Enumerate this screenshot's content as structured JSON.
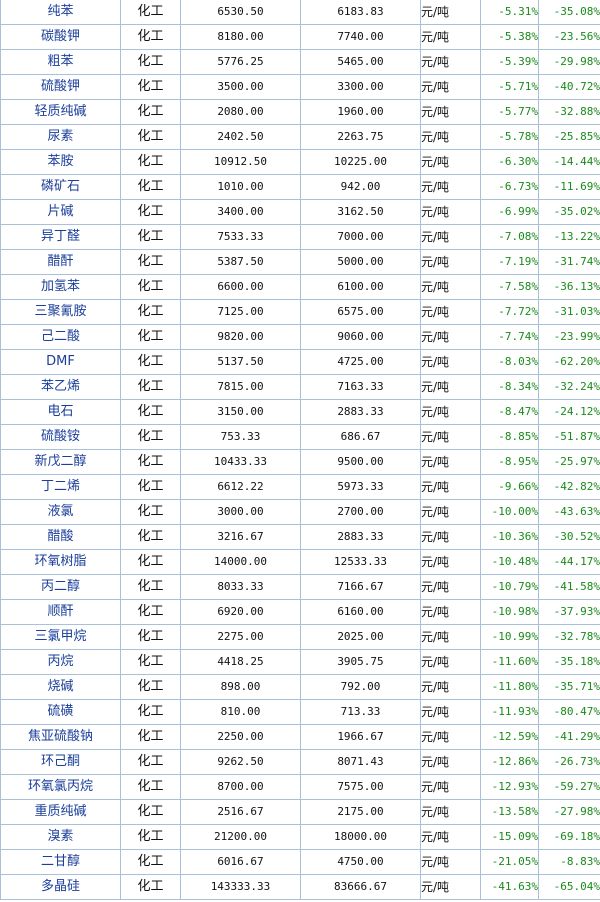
{
  "table": {
    "rows": [
      {
        "name": "纯苯",
        "category": "化工",
        "price_prev": "6530.50",
        "price_now": "6183.83",
        "unit": "元/吨",
        "change_period": "-5.31%",
        "change_year": "-35.08%"
      },
      {
        "name": "碳酸钾",
        "category": "化工",
        "price_prev": "8180.00",
        "price_now": "7740.00",
        "unit": "元/吨",
        "change_period": "-5.38%",
        "change_year": "-23.56%"
      },
      {
        "name": "粗苯",
        "category": "化工",
        "price_prev": "5776.25",
        "price_now": "5465.00",
        "unit": "元/吨",
        "change_period": "-5.39%",
        "change_year": "-29.98%"
      },
      {
        "name": "硫酸钾",
        "category": "化工",
        "price_prev": "3500.00",
        "price_now": "3300.00",
        "unit": "元/吨",
        "change_period": "-5.71%",
        "change_year": "-40.72%"
      },
      {
        "name": "轻质纯碱",
        "category": "化工",
        "price_prev": "2080.00",
        "price_now": "1960.00",
        "unit": "元/吨",
        "change_period": "-5.77%",
        "change_year": "-32.88%"
      },
      {
        "name": "尿素",
        "category": "化工",
        "price_prev": "2402.50",
        "price_now": "2263.75",
        "unit": "元/吨",
        "change_period": "-5.78%",
        "change_year": "-25.85%"
      },
      {
        "name": "苯胺",
        "category": "化工",
        "price_prev": "10912.50",
        "price_now": "10225.00",
        "unit": "元/吨",
        "change_period": "-6.30%",
        "change_year": "-14.44%"
      },
      {
        "name": "磷矿石",
        "category": "化工",
        "price_prev": "1010.00",
        "price_now": "942.00",
        "unit": "元/吨",
        "change_period": "-6.73%",
        "change_year": "-11.69%"
      },
      {
        "name": "片碱",
        "category": "化工",
        "price_prev": "3400.00",
        "price_now": "3162.50",
        "unit": "元/吨",
        "change_period": "-6.99%",
        "change_year": "-35.02%"
      },
      {
        "name": "异丁醛",
        "category": "化工",
        "price_prev": "7533.33",
        "price_now": "7000.00",
        "unit": "元/吨",
        "change_period": "-7.08%",
        "change_year": "-13.22%"
      },
      {
        "name": "醋酐",
        "category": "化工",
        "price_prev": "5387.50",
        "price_now": "5000.00",
        "unit": "元/吨",
        "change_period": "-7.19%",
        "change_year": "-31.74%"
      },
      {
        "name": "加氢苯",
        "category": "化工",
        "price_prev": "6600.00",
        "price_now": "6100.00",
        "unit": "元/吨",
        "change_period": "-7.58%",
        "change_year": "-36.13%"
      },
      {
        "name": "三聚氰胺",
        "category": "化工",
        "price_prev": "7125.00",
        "price_now": "6575.00",
        "unit": "元/吨",
        "change_period": "-7.72%",
        "change_year": "-31.03%"
      },
      {
        "name": "己二酸",
        "category": "化工",
        "price_prev": "9820.00",
        "price_now": "9060.00",
        "unit": "元/吨",
        "change_period": "-7.74%",
        "change_year": "-23.99%"
      },
      {
        "name": "DMF",
        "category": "化工",
        "price_prev": "5137.50",
        "price_now": "4725.00",
        "unit": "元/吨",
        "change_period": "-8.03%",
        "change_year": "-62.20%"
      },
      {
        "name": "苯乙烯",
        "category": "化工",
        "price_prev": "7815.00",
        "price_now": "7163.33",
        "unit": "元/吨",
        "change_period": "-8.34%",
        "change_year": "-32.24%"
      },
      {
        "name": "电石",
        "category": "化工",
        "price_prev": "3150.00",
        "price_now": "2883.33",
        "unit": "元/吨",
        "change_period": "-8.47%",
        "change_year": "-24.12%"
      },
      {
        "name": "硫酸铵",
        "category": "化工",
        "price_prev": "753.33",
        "price_now": "686.67",
        "unit": "元/吨",
        "change_period": "-8.85%",
        "change_year": "-51.87%"
      },
      {
        "name": "新戊二醇",
        "category": "化工",
        "price_prev": "10433.33",
        "price_now": "9500.00",
        "unit": "元/吨",
        "change_period": "-8.95%",
        "change_year": "-25.97%"
      },
      {
        "name": "丁二烯",
        "category": "化工",
        "price_prev": "6612.22",
        "price_now": "5973.33",
        "unit": "元/吨",
        "change_period": "-9.66%",
        "change_year": "-42.82%"
      },
      {
        "name": "液氯",
        "category": "化工",
        "price_prev": "3000.00",
        "price_now": "2700.00",
        "unit": "元/吨",
        "change_period": "-10.00%",
        "change_year": "-43.63%"
      },
      {
        "name": "醋酸",
        "category": "化工",
        "price_prev": "3216.67",
        "price_now": "2883.33",
        "unit": "元/吨",
        "change_period": "-10.36%",
        "change_year": "-30.52%"
      },
      {
        "name": "环氧树脂",
        "category": "化工",
        "price_prev": "14000.00",
        "price_now": "12533.33",
        "unit": "元/吨",
        "change_period": "-10.48%",
        "change_year": "-44.17%"
      },
      {
        "name": "丙二醇",
        "category": "化工",
        "price_prev": "8033.33",
        "price_now": "7166.67",
        "unit": "元/吨",
        "change_period": "-10.79%",
        "change_year": "-41.58%"
      },
      {
        "name": "顺酐",
        "category": "化工",
        "price_prev": "6920.00",
        "price_now": "6160.00",
        "unit": "元/吨",
        "change_period": "-10.98%",
        "change_year": "-37.93%"
      },
      {
        "name": "三氯甲烷",
        "category": "化工",
        "price_prev": "2275.00",
        "price_now": "2025.00",
        "unit": "元/吨",
        "change_period": "-10.99%",
        "change_year": "-32.78%"
      },
      {
        "name": "丙烷",
        "category": "化工",
        "price_prev": "4418.25",
        "price_now": "3905.75",
        "unit": "元/吨",
        "change_period": "-11.60%",
        "change_year": "-35.18%"
      },
      {
        "name": "烧碱",
        "category": "化工",
        "price_prev": "898.00",
        "price_now": "792.00",
        "unit": "元/吨",
        "change_period": "-11.80%",
        "change_year": "-35.71%"
      },
      {
        "name": "硫磺",
        "category": "化工",
        "price_prev": "810.00",
        "price_now": "713.33",
        "unit": "元/吨",
        "change_period": "-11.93%",
        "change_year": "-80.47%"
      },
      {
        "name": "焦亚硫酸钠",
        "category": "化工",
        "price_prev": "2250.00",
        "price_now": "1966.67",
        "unit": "元/吨",
        "change_period": "-12.59%",
        "change_year": "-41.29%"
      },
      {
        "name": "环己酮",
        "category": "化工",
        "price_prev": "9262.50",
        "price_now": "8071.43",
        "unit": "元/吨",
        "change_period": "-12.86%",
        "change_year": "-26.73%"
      },
      {
        "name": "环氧氯丙烷",
        "category": "化工",
        "price_prev": "8700.00",
        "price_now": "7575.00",
        "unit": "元/吨",
        "change_period": "-12.93%",
        "change_year": "-59.27%"
      },
      {
        "name": "重质纯碱",
        "category": "化工",
        "price_prev": "2516.67",
        "price_now": "2175.00",
        "unit": "元/吨",
        "change_period": "-13.58%",
        "change_year": "-27.98%"
      },
      {
        "name": "溴素",
        "category": "化工",
        "price_prev": "21200.00",
        "price_now": "18000.00",
        "unit": "元/吨",
        "change_period": "-15.09%",
        "change_year": "-69.18%"
      },
      {
        "name": "二甘醇",
        "category": "化工",
        "price_prev": "6016.67",
        "price_now": "4750.00",
        "unit": "元/吨",
        "change_period": "-21.05%",
        "change_year": "-8.83%"
      },
      {
        "name": "多晶硅",
        "category": "化工",
        "price_prev": "143333.33",
        "price_now": "83666.67",
        "unit": "元/吨",
        "change_period": "-41.63%",
        "change_year": "-65.04%"
      }
    ]
  },
  "colors": {
    "name_text": "#1b3f9a",
    "change_text": "#1a8a1a",
    "grid_border": "#a8c0d8"
  }
}
